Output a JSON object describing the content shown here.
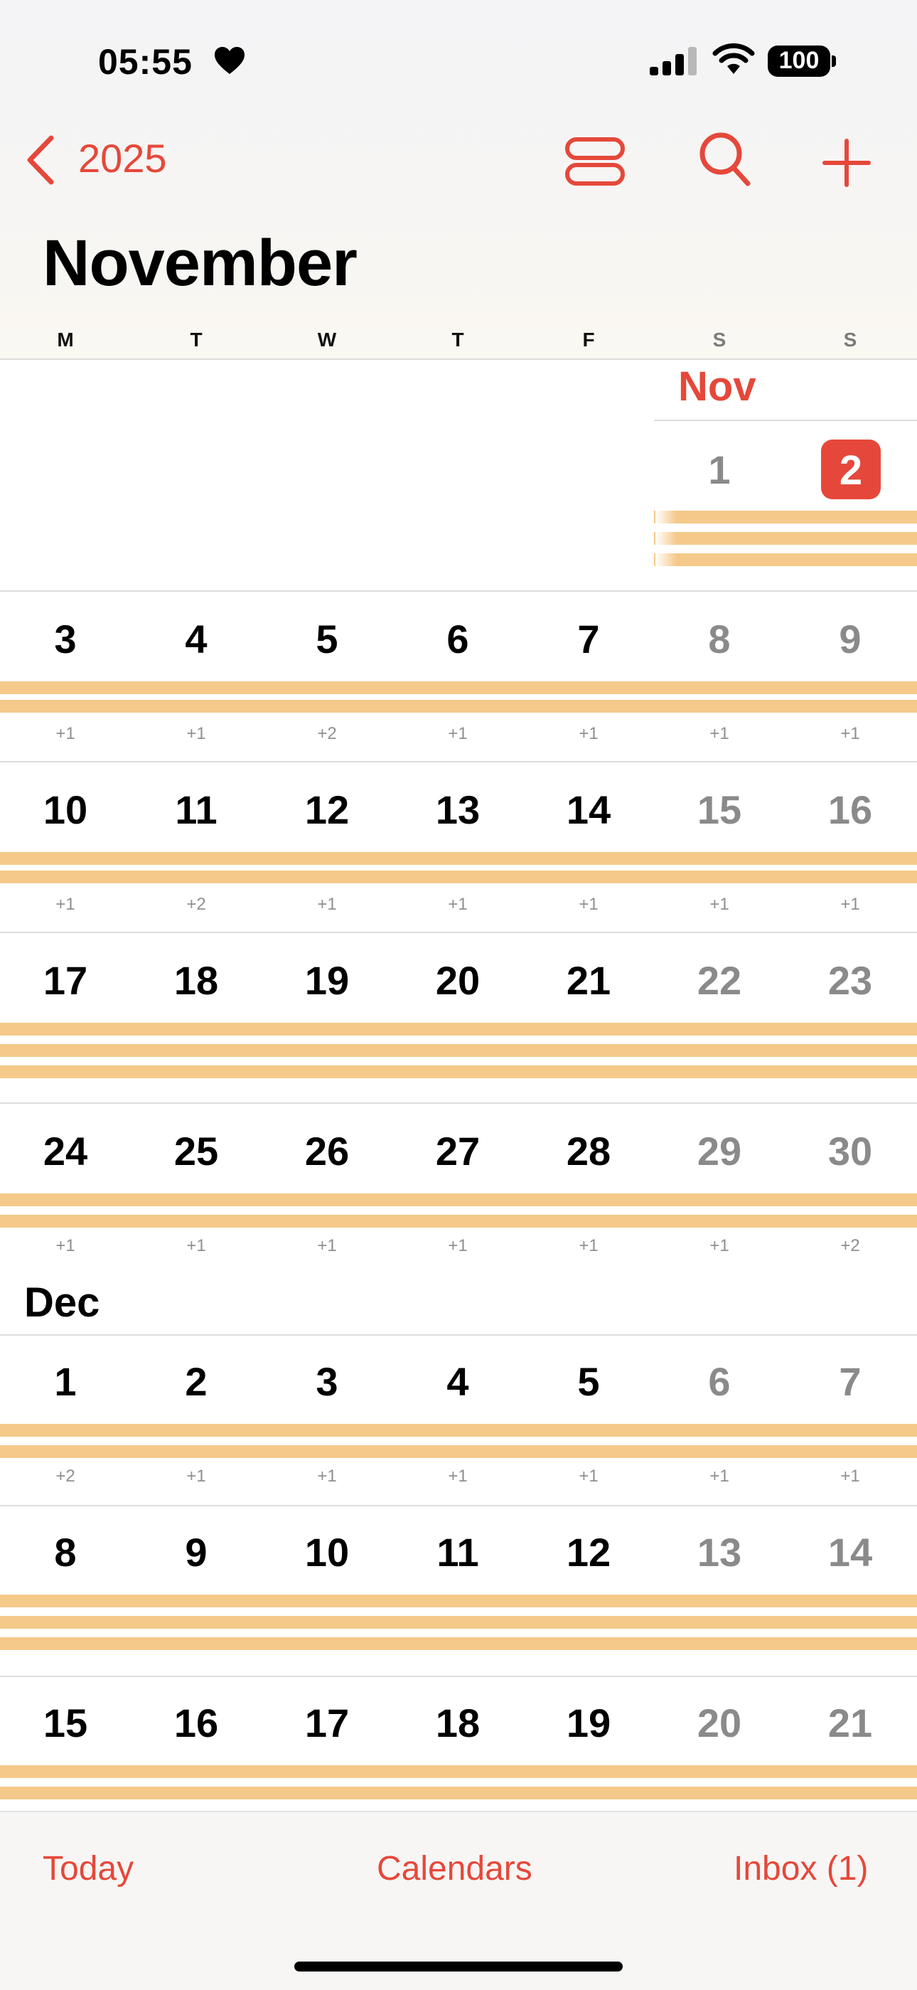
{
  "status_bar": {
    "time": "05:55",
    "battery": "100"
  },
  "nav": {
    "back_year": "2025"
  },
  "title": "November",
  "weekdays": [
    "M",
    "T",
    "W",
    "T",
    "F",
    "S",
    "S"
  ],
  "nov_label": "Nov",
  "dec_label": "Dec",
  "first_week": [
    "1",
    "2"
  ],
  "weeks": [
    {
      "days": [
        "3",
        "4",
        "5",
        "6",
        "7",
        "8",
        "9"
      ],
      "more": [
        "+1",
        "+1",
        "+2",
        "+1",
        "+1",
        "+1",
        "+1"
      ]
    },
    {
      "days": [
        "10",
        "11",
        "12",
        "13",
        "14",
        "15",
        "16"
      ],
      "more": [
        "+1",
        "+2",
        "+1",
        "+1",
        "+1",
        "+1",
        "+1"
      ]
    },
    {
      "days": [
        "17",
        "18",
        "19",
        "20",
        "21",
        "22",
        "23"
      ],
      "more": []
    },
    {
      "days": [
        "24",
        "25",
        "26",
        "27",
        "28",
        "29",
        "30"
      ],
      "more": [
        "+1",
        "+1",
        "+1",
        "+1",
        "+1",
        "+1",
        "+2"
      ]
    },
    {
      "days": [
        "1",
        "2",
        "3",
        "4",
        "5",
        "6",
        "7"
      ],
      "more": [
        "+2",
        "+1",
        "+1",
        "+1",
        "+1",
        "+1",
        "+1"
      ]
    },
    {
      "days": [
        "8",
        "9",
        "10",
        "11",
        "12",
        "13",
        "14"
      ],
      "more": []
    },
    {
      "days": [
        "15",
        "16",
        "17",
        "18",
        "19",
        "20",
        "21"
      ],
      "more": []
    }
  ],
  "tab_bar": {
    "today": "Today",
    "calendars": "Calendars",
    "inbox": "Inbox (1)"
  },
  "colors": {
    "accent": "#e5483a",
    "event_bar": "#f5c98a",
    "weekend_text": "#8a8a8a"
  },
  "icons": [
    "heart-icon",
    "signal-icon",
    "wifi-icon",
    "battery-icon",
    "chevron-left-icon",
    "view-toggle-icon",
    "search-icon",
    "plus-icon"
  ]
}
